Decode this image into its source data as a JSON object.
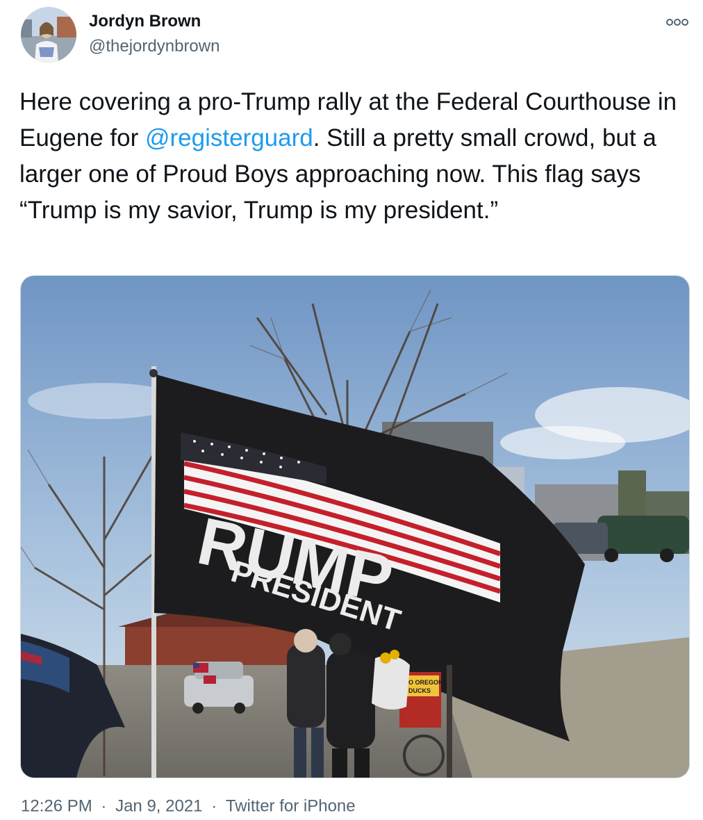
{
  "author": {
    "name": "Jordyn Brown",
    "handle": "@thejordynbrown"
  },
  "tweet": {
    "text_before": "Here covering a pro-Trump rally at the Federal Courthouse in Eugene for ",
    "mention": "@registerguard",
    "text_after": ". Still a pretty small crowd, but a larger one of Proud Boys approaching now. This flag says “Trump is my savior, Trump is my president.”"
  },
  "media": {
    "flag_text": "RUMP",
    "flag_subtext": "PRESIDENT",
    "sign_line1": "GO OREGON",
    "sign_line2": "DUCKS"
  },
  "meta": {
    "time": "12:26 PM",
    "date": "Jan 9, 2021",
    "source": "Twitter for iPhone",
    "separator": "·"
  },
  "colors": {
    "link": "#1d9bf0",
    "secondary": "#536471"
  },
  "icons": {
    "more": "more-dots-icon"
  }
}
